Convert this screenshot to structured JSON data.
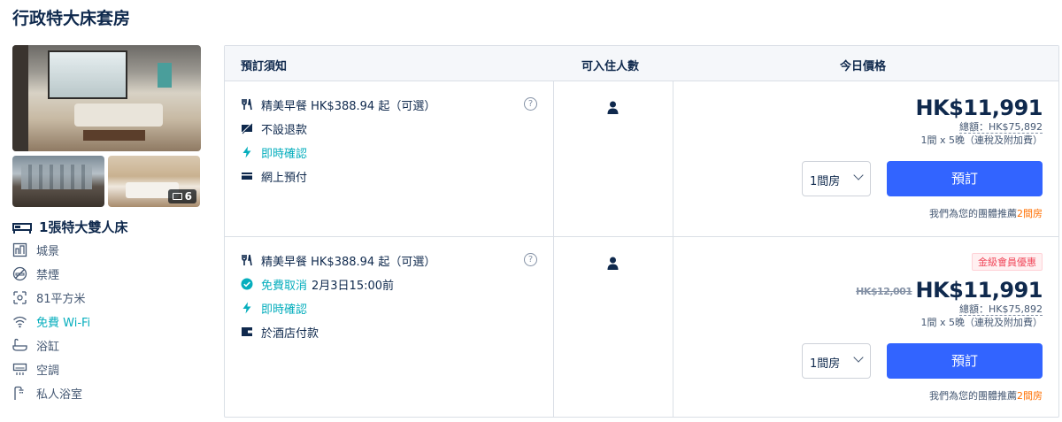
{
  "room_title": "行政特大床套房",
  "photos": {
    "count": "6"
  },
  "bed": "1張特大雙人床",
  "amenities": [
    {
      "label": "城景",
      "icon": "city-view-icon"
    },
    {
      "label": "禁煙",
      "icon": "no-smoking-icon"
    },
    {
      "label": "81平方米",
      "icon": "area-icon"
    },
    {
      "label": "免費 Wi-Fi",
      "icon": "wifi-icon"
    },
    {
      "label": "浴缸",
      "icon": "bathtub-icon"
    },
    {
      "label": "空調",
      "icon": "air-conditioner-icon"
    },
    {
      "label": "私人浴室",
      "icon": "shower-icon"
    }
  ],
  "table": {
    "headers": {
      "conditions": "預訂須知",
      "occupancy": "可入住人數",
      "price": "今日價格"
    },
    "rows": [
      {
        "breakfast": "精美早餐 HK$388.94 起（可選）",
        "cancel": "不設退款",
        "confirm": "即時確認",
        "payment": "網上預付",
        "price": "HK$11,991",
        "total": "總額：HK$75,892",
        "stay": "1間 x 5晚（連稅及附加費）",
        "rooms_select": "1間房",
        "book_label": "預訂",
        "recommend_prefix": "我們為您的團體推薦",
        "recommend_count": "2間房"
      },
      {
        "breakfast": "精美早餐 HK$388.94 起（可選）",
        "cancel": "免費取消",
        "cancel_deadline": "2月3日15:00前",
        "confirm": "即時確認",
        "payment": "於酒店付款",
        "badge": "金級會員優惠",
        "original_price": "HK$12,001",
        "price": "HK$11,991",
        "total": "總額：HK$75,892",
        "stay": "1間 x 5晚（連稅及附加費）",
        "rooms_select": "1間房",
        "book_label": "預訂",
        "recommend_prefix": "我們為您的團體推薦",
        "recommend_count": "2間房"
      }
    ]
  },
  "colors": {
    "primary": "#3264ff",
    "teal": "#06aebd",
    "orange": "#ff6f00",
    "text": "#0f294d",
    "badge": "#f0475a"
  }
}
